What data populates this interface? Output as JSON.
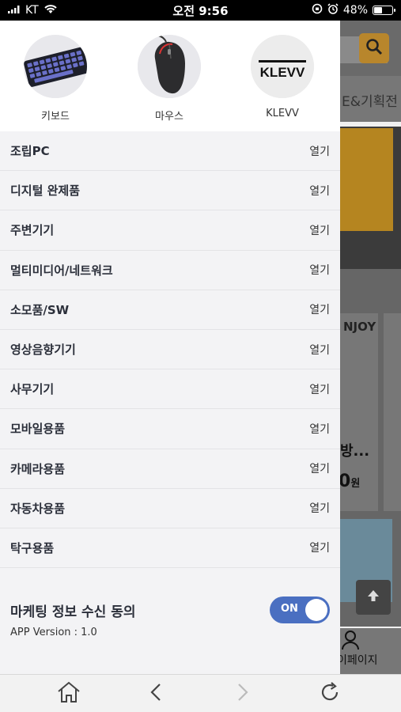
{
  "status_bar": {
    "carrier": "KT",
    "time": "오전 9:56",
    "battery": "48%",
    "battery_level": 0.48
  },
  "background": {
    "tab_text": "E&기획전",
    "card_brand": "NJOY",
    "product_title": "방...",
    "price": "0",
    "price_unit": "원",
    "nav_label": "이페이지"
  },
  "brands": [
    {
      "label": "키보드",
      "icon": "keyboard-image"
    },
    {
      "label": "마우스",
      "icon": "mouse-image"
    },
    {
      "label": "KLEVV",
      "icon": "klevv-logo",
      "logo_text": "KLEVV"
    }
  ],
  "menu": [
    {
      "name": "조립PC",
      "action": "열기"
    },
    {
      "name": "디지털 완제품",
      "action": "열기"
    },
    {
      "name": "주변기기",
      "action": "열기"
    },
    {
      "name": "멀티미디어/네트워크",
      "action": "열기"
    },
    {
      "name": "소모품/SW",
      "action": "열기"
    },
    {
      "name": "영상음향기기",
      "action": "열기"
    },
    {
      "name": "사무기기",
      "action": "열기"
    },
    {
      "name": "모바일용품",
      "action": "열기"
    },
    {
      "name": "카메라용품",
      "action": "열기"
    },
    {
      "name": "자동차용품",
      "action": "열기"
    },
    {
      "name": "탁구용품",
      "action": "열기"
    }
  ],
  "settings": {
    "marketing_label": "마케팅 정보 수신 동의",
    "toggle_label": "ON",
    "toggle_on": true,
    "version": "APP Version : 1.0"
  },
  "colors": {
    "toggle": "#4a6fc1",
    "search_button": "#b8862c"
  },
  "toolbar": [
    "home-icon",
    "back-icon",
    "forward-icon",
    "refresh-icon"
  ]
}
